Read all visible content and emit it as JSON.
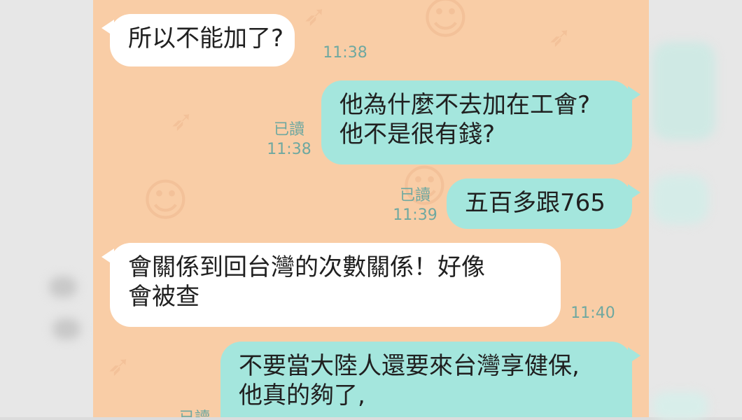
{
  "messages": [
    {
      "dir": "in",
      "lines": [
        "所以不能加了?"
      ],
      "time": "11:38"
    },
    {
      "dir": "out",
      "lines": [
        "他為什麼不去加在工會?",
        "他不是很有錢?"
      ],
      "read": "已讀",
      "time": "11:38"
    },
    {
      "dir": "out",
      "lines": [
        "五百多跟765"
      ],
      "read": "已讀",
      "time": "11:39"
    },
    {
      "dir": "in",
      "lines": [
        "會關係到回台灣的次數關係！好像",
        "會被查"
      ],
      "time": "11:40"
    },
    {
      "dir": "out",
      "lines": [
        "不要當大陸人還要來台灣享健保,",
        "他真的夠了,"
      ],
      "read": "已讀"
    }
  ],
  "colors": {
    "chat_bg": "#f9cda6",
    "bubble_in": "#ffffff",
    "bubble_out": "#a4e6dd",
    "meta_text": "#6fa8a0"
  }
}
